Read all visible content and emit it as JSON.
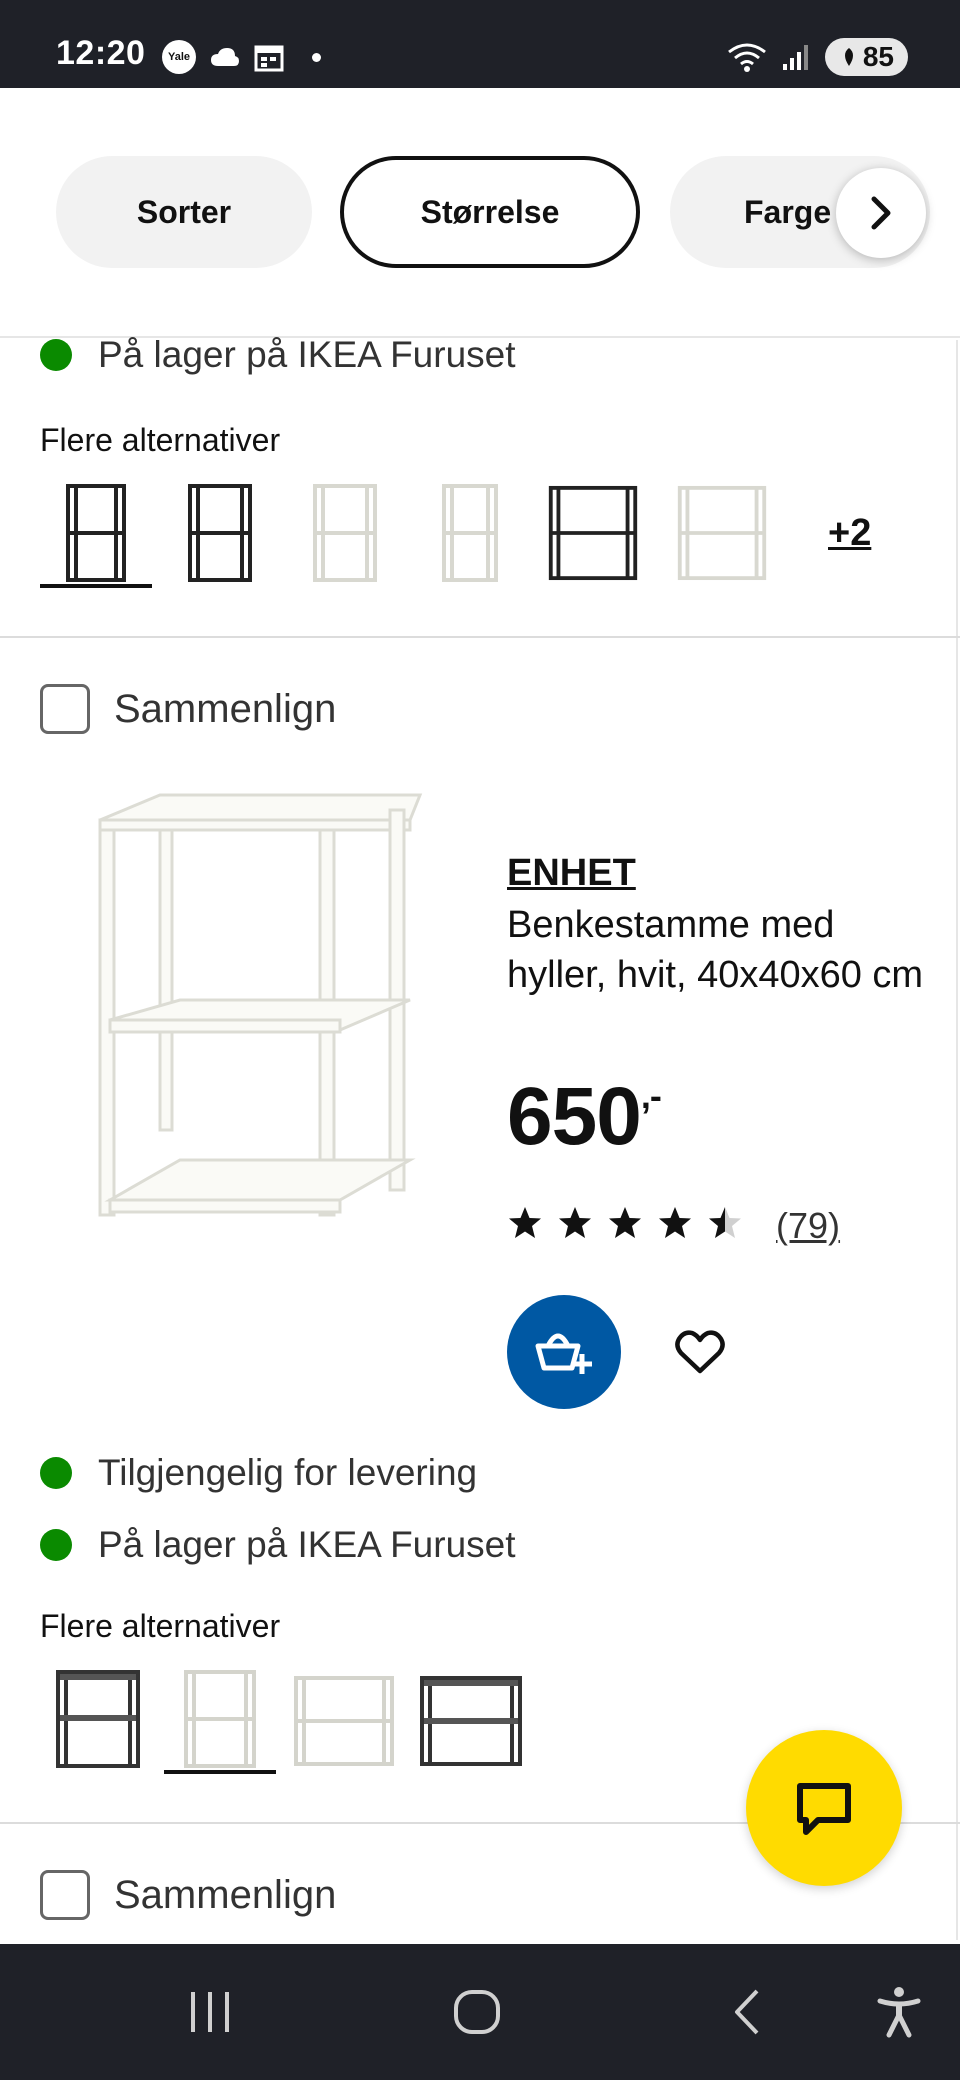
{
  "status_bar": {
    "time": "12:20",
    "yale_label": "Yale",
    "battery": "85",
    "icons": [
      "yale-icon",
      "cloud-icon",
      "calendar-icon",
      "dot-icon",
      "wifi-icon",
      "signal-icon",
      "battery-icon"
    ]
  },
  "filters": {
    "sorter": "Sorter",
    "storrelse": "Størrelse",
    "farge": "Farge"
  },
  "product_prev": {
    "stock": "På lager på IKEA Furuset",
    "alternatives_title": "Flere alternativer",
    "more_alternatives": "+2",
    "thumbs": [
      "black",
      "black",
      "white",
      "white",
      "black",
      "white"
    ]
  },
  "product": {
    "compare_label": "Sammenlign",
    "brand": "ENHET",
    "description": "Benkestamme med hyller, hvit, 40x40x60 cm",
    "price": "650",
    "price_suffix": ",-",
    "rating": 4.5,
    "review_count": "(79)",
    "delivery": "Tilgjengelig for levering",
    "stock": "På lager på IKEA Furuset",
    "alternatives_title": "Flere alternativer",
    "thumbs": [
      "black",
      "white",
      "white",
      "black"
    ],
    "accent_color": "#0058a3",
    "stock_color": "#0a8a00"
  },
  "product_next": {
    "compare_label": "Sammenlign"
  },
  "chat": {
    "color": "#ffdb00"
  }
}
